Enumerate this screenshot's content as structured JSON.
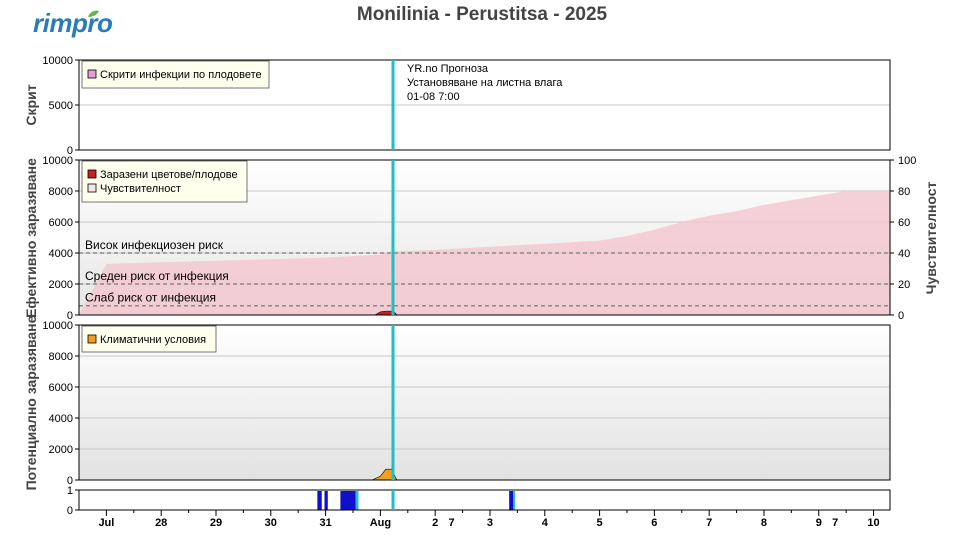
{
  "logo_text": "rimpro",
  "title": "Monilinia - Perustitsa - 2025",
  "colors": {
    "now_line": "#1fbfc8",
    "risk_fill": "#f5c6ce",
    "infection_bar": "#cc2020",
    "climate_fill": "#f0a020",
    "wet": "#1010c8",
    "wet_light": "#27b6ee",
    "scab_legend": "#e8a0d0",
    "sens_legend": "#f5e6e6"
  },
  "forecast_note": {
    "line1": "YR.no Прогноза",
    "line2": "Установяване на листна влага",
    "line3": "01-08 7:00"
  },
  "chart_data": [
    {
      "type": "area",
      "panel": "hidden_infections",
      "ylabel": "Скрит",
      "ylim": [
        0,
        10000
      ],
      "yticks": [
        "0",
        "5000",
        "10000"
      ],
      "legend": [
        "Скрити инфекции по плодовете"
      ],
      "series": []
    },
    {
      "type": "area",
      "panel": "effective_infection",
      "ylabel": "Ефективно заразяване",
      "ylabel_right": "Чувствителност",
      "ylim": [
        0,
        10000
      ],
      "ylim_right": [
        0,
        100
      ],
      "yticks": [
        "0",
        "2000",
        "4000",
        "6000",
        "8000",
        "10000"
      ],
      "yticks_right": [
        "0",
        "20",
        "40",
        "60",
        "80",
        "100"
      ],
      "legend": [
        "Заразени цветове/плодове",
        "Чувствителност"
      ],
      "risk_lines": [
        {
          "label": "Висок инфекциозен риск",
          "value": 4000
        },
        {
          "label": "Среден риск от инфекция",
          "value": 2000
        },
        {
          "label": "Слаб риск от инфекция",
          "value": 600
        }
      ],
      "sensitivity_x": [
        27.0,
        28.0,
        29.0,
        30.0,
        31.0,
        31.5,
        32.0,
        32.2,
        33.0,
        34.0,
        35.0,
        36.0,
        36.5,
        37.0,
        37.5,
        38.0,
        38.5,
        39.0,
        39.5,
        40.0,
        40.5
      ],
      "sensitivity": [
        33,
        34,
        35,
        36,
        37,
        38,
        39,
        41,
        42,
        44,
        46,
        48,
        51,
        55,
        60,
        64,
        67,
        71,
        74,
        77,
        80
      ],
      "infection_x": [
        31.9,
        32.0,
        32.1,
        32.2,
        32.25,
        32.3
      ],
      "infection": [
        0,
        200,
        250,
        250,
        200,
        0
      ]
    },
    {
      "type": "area",
      "panel": "potential_infection",
      "ylabel": "Потенциално заразяване",
      "ylim": [
        0,
        10000
      ],
      "yticks": [
        "0",
        "2000",
        "4000",
        "6000",
        "8000",
        "10000"
      ],
      "legend": [
        "Климатични условия"
      ],
      "climate_x": [
        31.85,
        32.0,
        32.1,
        32.2,
        32.25,
        32.3
      ],
      "climate": [
        0,
        250,
        700,
        700,
        350,
        0
      ]
    },
    {
      "type": "bar",
      "panel": "leaf_wetness",
      "ylim": [
        0,
        1
      ],
      "yticks": [
        "0",
        "1"
      ],
      "wet_periods": [
        [
          30.85,
          30.93
        ],
        [
          30.98,
          31.04
        ],
        [
          31.27,
          31.55
        ],
        [
          34.35,
          34.42
        ]
      ],
      "wet_light_periods": [
        [
          31.55,
          31.6
        ],
        [
          34.42,
          34.46
        ]
      ]
    }
  ],
  "x_axis": {
    "xlim": [
      26.5,
      41.3
    ],
    "labels": [
      {
        "label": "Jul",
        "x": 27.0
      },
      {
        "label": "28",
        "x": 28.0
      },
      {
        "label": "29",
        "x": 29.0
      },
      {
        "label": "30",
        "x": 30.0
      },
      {
        "label": "31",
        "x": 31.0
      },
      {
        "label": "Aug",
        "x": 32.0
      },
      {
        "label": "2",
        "x": 33.0
      },
      {
        "label": "7",
        "x": 33.3
      },
      {
        "label": "3",
        "x": 34.0
      },
      {
        "label": "4",
        "x": 35.0
      },
      {
        "label": "5",
        "x": 36.0
      },
      {
        "label": "6",
        "x": 37.0
      },
      {
        "label": "7",
        "x": 38.0
      },
      {
        "label": "8",
        "x": 39.0
      },
      {
        "label": "9",
        "x": 40.0
      },
      {
        "label": "7",
        "x": 40.3
      },
      {
        "label": "10",
        "x": 41.0
      }
    ],
    "now": 32.23
  }
}
